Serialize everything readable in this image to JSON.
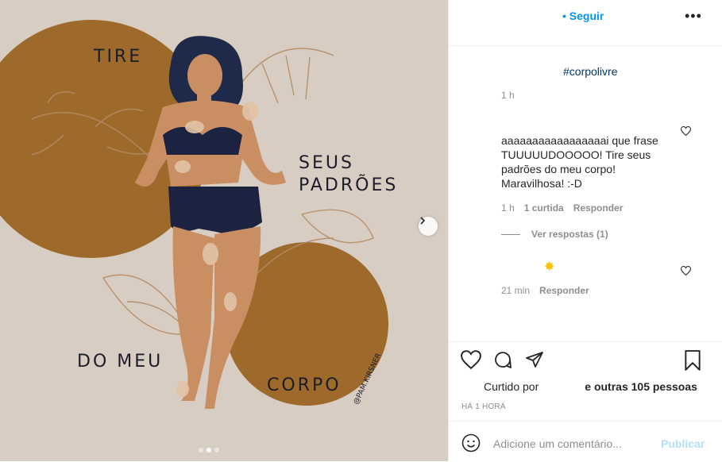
{
  "header": {
    "follow_label": "• Seguir",
    "more_label": "•••"
  },
  "caption": {
    "hashtag": "#corpolivre",
    "time": "1 h"
  },
  "artwork": {
    "text_tire": "TIRE",
    "text_seus": "SEUS",
    "text_padroes": "PADRÕES",
    "text_do_meu": "DO MEU",
    "text_corpo": "CORPO",
    "signature": "@PAM.KIRSNER"
  },
  "comments": [
    {
      "text": "aaaaaaaaaaaaaaaaai que frase TUUUUUDOOOOO! Tire seus padrões do meu corpo! Maravilhosa! :-D",
      "time": "1 h",
      "likes": "1 curtida",
      "reply": "Responder",
      "view_replies": "Ver respostas (1)"
    },
    {
      "emoji": "✸",
      "time": "21 min",
      "reply": "Responder"
    }
  ],
  "likes": {
    "prefix": "Curtido por",
    "suffix": "e outras 105 pessoas"
  },
  "posted": "HÁ 1 HORA",
  "add_comment": {
    "placeholder": "Adicione um comentário...",
    "publish": "Publicar"
  },
  "carousel": {
    "total": 3,
    "active": 2
  }
}
